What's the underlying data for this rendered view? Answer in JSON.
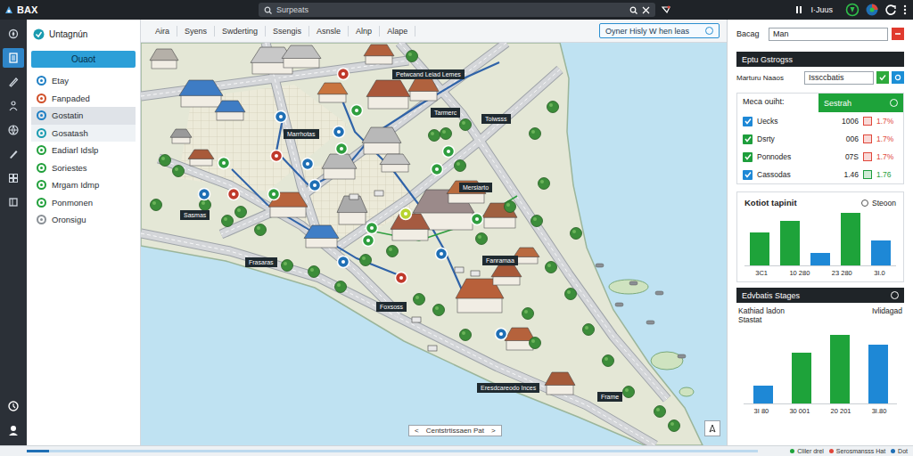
{
  "topbar": {
    "logo": "BAX",
    "search": {
      "placeholder": "Surpeats"
    },
    "user": "I·Juus"
  },
  "rail": {
    "items": [
      {
        "selected": false
      },
      {
        "selected": true
      },
      {
        "selected": false
      },
      {
        "selected": false
      },
      {
        "selected": false
      },
      {
        "selected": false
      },
      {
        "selected": false
      },
      {
        "selected": false
      },
      {
        "selected": false
      },
      {
        "selected": false
      }
    ]
  },
  "sidebar": {
    "title": "Untagnún",
    "button": "Ouaot",
    "items": [
      {
        "label": "Etay",
        "selected": false,
        "hovered": false,
        "color": "#1f7fc4"
      },
      {
        "label": "Fanpaded",
        "selected": false,
        "hovered": false,
        "color": "#d0502a"
      },
      {
        "label": "Gostatin",
        "selected": true,
        "hovered": false,
        "color": "#1f7fc4"
      },
      {
        "label": "Gosatash",
        "selected": false,
        "hovered": true,
        "color": "#1a9bb0"
      },
      {
        "label": "Eadiarl Idslp",
        "selected": false,
        "hovered": false,
        "color": "#22a03c"
      },
      {
        "label": "Soriestes",
        "selected": false,
        "hovered": false,
        "color": "#22a03c"
      },
      {
        "label": "Mrgam Idmp",
        "selected": false,
        "hovered": false,
        "color": "#22a03c"
      },
      {
        "label": "Ponmonen",
        "selected": false,
        "hovered": false,
        "color": "#22a03c"
      },
      {
        "label": "Oronsigu",
        "selected": false,
        "hovered": false,
        "color": "#8a9096"
      }
    ]
  },
  "map_tabs": {
    "tabs": [
      {
        "label": "Aira",
        "selected": false
      },
      {
        "label": "Syens",
        "selected": false
      },
      {
        "label": "Swderting",
        "selected": false
      },
      {
        "label": "Ssengis",
        "selected": false
      },
      {
        "label": "Asnsle",
        "selected": false
      },
      {
        "label": "Alnp",
        "selected": false
      },
      {
        "label": "Alape",
        "selected": false
      }
    ],
    "action": "Oyner Hisly W hen leas"
  },
  "map": {
    "labels": [
      "Petwcand Leiad Lemes",
      "Tarmerc",
      "Toiwsss",
      "Marrhotas",
      "Mersiarto",
      "Sasmas",
      "Frasaras",
      "Fanramaa",
      "Foxsoss",
      "Eresdcareodo Inces",
      "Frame"
    ],
    "pins": [
      {
        "color": "#c0392b"
      },
      {
        "color": "#2e9e3e"
      },
      {
        "color": "#1f6fb5"
      },
      {
        "color": "#1f6fb5"
      },
      {
        "color": "#c0392b"
      },
      {
        "color": "#1f6fb5"
      },
      {
        "color": "#2e9e3e"
      },
      {
        "color": "#1f6fb5"
      },
      {
        "color": "#2e9e3e"
      },
      {
        "color": "#2e9e3e"
      },
      {
        "color": "#1f6fb5"
      },
      {
        "color": "#c0392b"
      },
      {
        "color": "#2e9e3e"
      },
      {
        "color": "#2e9e3e"
      },
      {
        "color": "#b8d430"
      },
      {
        "color": "#2e9e3e"
      },
      {
        "color": "#2e9e3e"
      },
      {
        "color": "#1f6fb5"
      },
      {
        "color": "#2e9e3e"
      },
      {
        "color": "#c0392b"
      },
      {
        "color": "#1f6fb5"
      },
      {
        "color": "#1f6fb5"
      }
    ],
    "footer": {
      "prev": "<",
      "label": "Centstrtissaen Pat",
      "next": ">"
    }
  },
  "right_panel": {
    "search_row": {
      "label": "Bacag",
      "value": "Man"
    },
    "filters": {
      "title": "Eptu Gstrogss",
      "label": "Marturu Naaos",
      "value": "Issccbatis"
    },
    "table": {
      "columns": [
        "Meca ouiht:",
        "Sestrah"
      ],
      "rows": [
        {
          "checked": true,
          "color": "#1e88d6",
          "name": "Uecks",
          "value": "1006",
          "flag_color": "#e0463a",
          "change": "1.7%"
        },
        {
          "checked": true,
          "color": "#1e9e3c",
          "name": "Dsrty",
          "value": "006",
          "flag_color": "#e0463a",
          "change": "1.7%"
        },
        {
          "checked": true,
          "color": "#1e9e3c",
          "name": "Ponnodes",
          "value": "07S",
          "flag_color": "#e0463a",
          "change": "1.7%"
        },
        {
          "checked": true,
          "color": "#1e88d6",
          "name": "Cassodas",
          "value": "1.46",
          "flag_color": "#1e9e3c",
          "change": "1.76"
        }
      ]
    },
    "chart1": {
      "title": "Kotiot tapinit",
      "legend": "Steoon",
      "max": 60,
      "bars": [
        {
          "value": 37,
          "color": "#1ea33a"
        },
        {
          "value": 50,
          "color": "#1ea33a"
        },
        {
          "value": 14,
          "color": "#1e88d6"
        },
        {
          "value": 59,
          "color": "#1ea33a"
        },
        {
          "value": 28,
          "color": "#1e88d6"
        }
      ],
      "labels": [
        "3C1",
        "10 280",
        "23 280",
        "3I.0"
      ]
    },
    "chart2": {
      "title": "Edvbatis Stages",
      "subtitle_lines": [
        "Kathiad ladon",
        "Stastat"
      ],
      "side": "Ivlidagad",
      "max": 80,
      "bars": [
        {
          "value": 20,
          "color": "#1e88d6"
        },
        {
          "value": 57,
          "color": "#1ea33a"
        },
        {
          "value": 77,
          "color": "#1ea33a"
        },
        {
          "value": 66,
          "color": "#1e88d6"
        }
      ],
      "labels": [
        "3I 80",
        "30 001",
        "20 201",
        "3I.80"
      ]
    }
  },
  "status_bar": {
    "progress": {
      "level": 0.03
    },
    "items": [
      {
        "label": "Cliler drel",
        "color": "#1ea33a"
      },
      {
        "label": "Serosmansss Hat",
        "color": "#e0463a"
      },
      {
        "label": "Dot",
        "color": "#1f6fb5"
      }
    ]
  }
}
